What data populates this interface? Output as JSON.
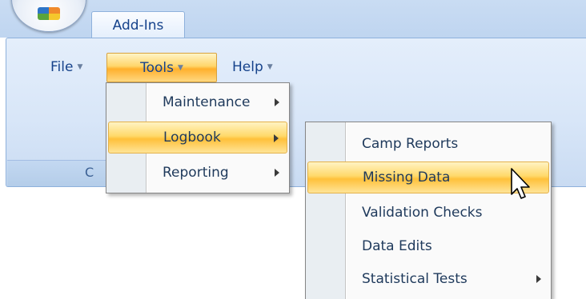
{
  "tabs": {
    "addins": "Add-Ins"
  },
  "ribbon": {
    "file_label": "File",
    "tools_label": "Tools",
    "help_label": "Help",
    "group_caption": "C"
  },
  "tools_menu": {
    "items": [
      {
        "label": "Maintenance",
        "has_submenu": true
      },
      {
        "label": "Logbook",
        "has_submenu": true,
        "highlighted": true
      },
      {
        "label": "Reporting",
        "has_submenu": true
      }
    ]
  },
  "logbook_menu": {
    "items": [
      {
        "label": "Camp Reports",
        "has_submenu": false
      },
      {
        "label": "Missing Data",
        "has_submenu": false,
        "highlighted": true
      },
      {
        "label": "Validation Checks",
        "has_submenu": false
      },
      {
        "label": "Data Edits",
        "has_submenu": false
      },
      {
        "label": "Statistical Tests",
        "has_submenu": true
      }
    ]
  },
  "colors": {
    "ribbon_text": "#15428b",
    "highlight": "#ffc13a",
    "menu_text": "#1e395b"
  },
  "icons": [
    "office-orb-icon",
    "dropdown-caret-icon",
    "submenu-arrow-icon",
    "mouse-pointer-icon"
  ]
}
